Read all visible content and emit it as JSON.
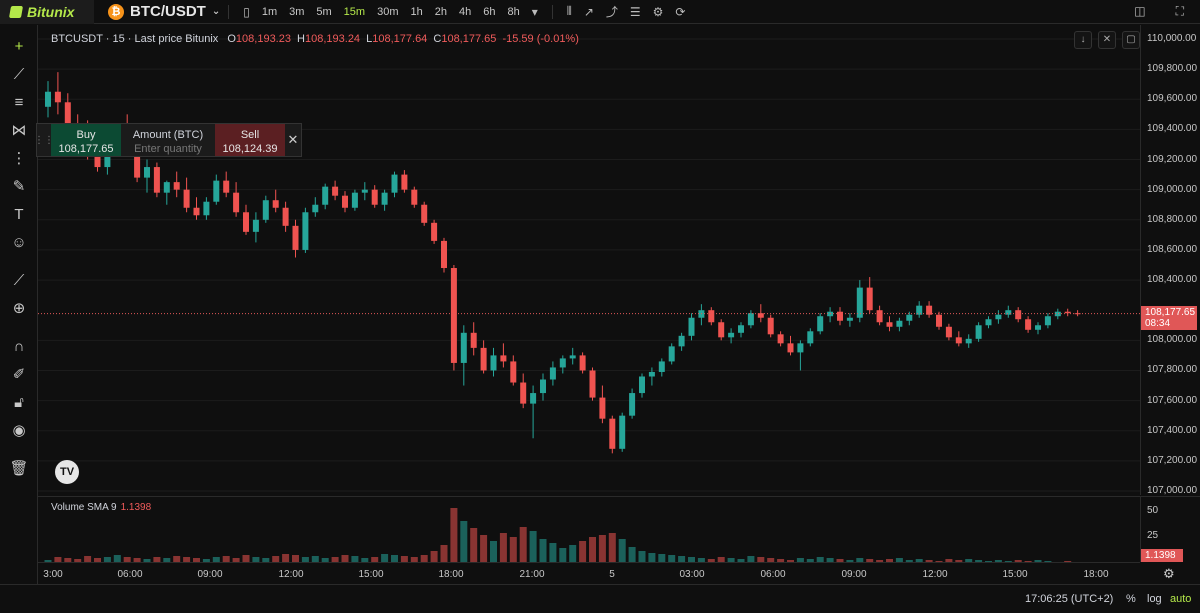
{
  "topbar": {
    "brand": "Bitunix",
    "symbol": "BTC/USDT",
    "timeframes": [
      {
        "label": "1m",
        "active": false
      },
      {
        "label": "3m",
        "active": false
      },
      {
        "label": "5m",
        "active": false
      },
      {
        "label": "15m",
        "active": true
      },
      {
        "label": "30m",
        "active": false
      },
      {
        "label": "1h",
        "active": false
      },
      {
        "label": "2h",
        "active": false
      },
      {
        "label": "4h",
        "active": false
      },
      {
        "label": "6h",
        "active": false
      },
      {
        "label": "8h",
        "active": false
      }
    ]
  },
  "legend": {
    "title": "BTCUSDT · 15 · Last price Bitunix",
    "o_label": "O",
    "o": "108,193.23",
    "h_label": "H",
    "h": "108,193.24",
    "l_label": "L",
    "l": "108,177.64",
    "c_label": "C",
    "c": "108,177.65",
    "change": "-15.59 (-0.01%)"
  },
  "order_panel": {
    "buy_label": "Buy",
    "buy_price": "108,177.65",
    "amount_label": "Amount (BTC)",
    "amount_placeholder": "Enter quantity",
    "sell_label": "Sell",
    "sell_price": "108,124.39"
  },
  "price_axis": {
    "ticks": [
      "110,000.00",
      "109,800.00",
      "109,600.00",
      "109,400.00",
      "109,200.00",
      "109,000.00",
      "108,800.00",
      "108,600.00",
      "108,400.00",
      "108,000.00",
      "107,800.00",
      "107,600.00",
      "107,400.00",
      "107,200.00",
      "107,000.00"
    ],
    "last_price": "108,177.65",
    "countdown": "08:34"
  },
  "volume": {
    "label": "Volume SMA 9",
    "value": "1.1398",
    "ticks": [
      "50",
      "25"
    ],
    "last": "1.1398"
  },
  "time_axis": {
    "ticks": [
      "3:00",
      "06:00",
      "09:00",
      "12:00",
      "15:00",
      "18:00",
      "21:00",
      "5",
      "03:00",
      "06:00",
      "09:00",
      "12:00",
      "15:00",
      "18:00"
    ]
  },
  "status": {
    "time": "17:06:25 (UTC+2)",
    "percent": "%",
    "log": "log",
    "auto": "auto"
  },
  "colors": {
    "up": "#26a69a",
    "down": "#ef5350",
    "accent": "#b4e84a"
  },
  "chart_data": {
    "type": "candlestick",
    "ylim": [
      107000,
      110000
    ],
    "candles": [
      [
        109550,
        109720,
        109480,
        109650
      ],
      [
        109650,
        109780,
        109500,
        109580
      ],
      [
        109580,
        109640,
        109380,
        109420
      ],
      [
        109420,
        109500,
        109300,
        109380
      ],
      [
        109380,
        109460,
        109200,
        109260
      ],
      [
        109260,
        109320,
        109120,
        109150
      ],
      [
        109150,
        109330,
        109100,
        109300
      ],
      [
        109300,
        109420,
        109250,
        109380
      ],
      [
        109380,
        109500,
        109220,
        109250
      ],
      [
        109250,
        109300,
        109050,
        109080
      ],
      [
        109080,
        109200,
        108980,
        109150
      ],
      [
        109150,
        109180,
        108950,
        108980
      ],
      [
        108980,
        109060,
        108900,
        109050
      ],
      [
        109050,
        109120,
        108950,
        109000
      ],
      [
        109000,
        109080,
        108850,
        108880
      ],
      [
        108880,
        108950,
        108800,
        108830
      ],
      [
        108830,
        108950,
        108800,
        108920
      ],
      [
        108920,
        109100,
        108900,
        109060
      ],
      [
        109060,
        109120,
        108950,
        108980
      ],
      [
        108980,
        109050,
        108820,
        108850
      ],
      [
        108850,
        108900,
        108700,
        108720
      ],
      [
        108720,
        108850,
        108650,
        108800
      ],
      [
        108800,
        108960,
        108780,
        108930
      ],
      [
        108930,
        109000,
        108850,
        108880
      ],
      [
        108880,
        108920,
        108720,
        108760
      ],
      [
        108760,
        108800,
        108550,
        108600
      ],
      [
        108600,
        108880,
        108580,
        108850
      ],
      [
        108850,
        108950,
        108820,
        108900
      ],
      [
        108900,
        109040,
        108870,
        109020
      ],
      [
        109020,
        109060,
        108930,
        108960
      ],
      [
        108960,
        108990,
        108850,
        108880
      ],
      [
        108880,
        109000,
        108860,
        108980
      ],
      [
        108980,
        109050,
        108930,
        109000
      ],
      [
        109000,
        109030,
        108880,
        108900
      ],
      [
        108900,
        109000,
        108860,
        108980
      ],
      [
        108980,
        109120,
        108950,
        109100
      ],
      [
        109100,
        109130,
        108980,
        109000
      ],
      [
        109000,
        109020,
        108880,
        108900
      ],
      [
        108900,
        108920,
        108760,
        108780
      ],
      [
        108780,
        108800,
        108640,
        108660
      ],
      [
        108660,
        108680,
        108450,
        108480
      ],
      [
        108480,
        108500,
        107800,
        107850
      ],
      [
        107850,
        108100,
        107700,
        108050
      ],
      [
        108050,
        108120,
        107900,
        107950
      ],
      [
        107950,
        108000,
        107780,
        107800
      ],
      [
        107800,
        107950,
        107760,
        107900
      ],
      [
        107900,
        107980,
        107820,
        107860
      ],
      [
        107860,
        107900,
        107700,
        107720
      ],
      [
        107720,
        107780,
        107550,
        107580
      ],
      [
        107580,
        107700,
        107350,
        107650
      ],
      [
        107650,
        107780,
        107600,
        107740
      ],
      [
        107740,
        107860,
        107700,
        107820
      ],
      [
        107820,
        107900,
        107780,
        107880
      ],
      [
        107880,
        107950,
        107840,
        107900
      ],
      [
        107900,
        107920,
        107780,
        107800
      ],
      [
        107800,
        107820,
        107600,
        107620
      ],
      [
        107620,
        107700,
        107450,
        107480
      ],
      [
        107480,
        107500,
        107250,
        107280
      ],
      [
        107280,
        107520,
        107260,
        107500
      ],
      [
        107500,
        107680,
        107480,
        107650
      ],
      [
        107650,
        107780,
        107620,
        107760
      ],
      [
        107760,
        107820,
        107700,
        107790
      ],
      [
        107790,
        107880,
        107760,
        107860
      ],
      [
        107860,
        107980,
        107840,
        107960
      ],
      [
        107960,
        108050,
        107930,
        108030
      ],
      [
        108030,
        108180,
        108000,
        108150
      ],
      [
        108150,
        108240,
        108100,
        108200
      ],
      [
        108200,
        108220,
        108100,
        108120
      ],
      [
        108120,
        108140,
        108000,
        108020
      ],
      [
        108020,
        108080,
        107980,
        108050
      ],
      [
        108050,
        108120,
        108020,
        108100
      ],
      [
        108100,
        108200,
        108080,
        108180
      ],
      [
        108180,
        108240,
        108120,
        108150
      ],
      [
        108150,
        108170,
        108020,
        108040
      ],
      [
        108040,
        108060,
        107960,
        107980
      ],
      [
        107980,
        108030,
        107900,
        107920
      ],
      [
        107920,
        108000,
        107800,
        107980
      ],
      [
        107980,
        108080,
        107960,
        108060
      ],
      [
        108060,
        108180,
        108040,
        108160
      ],
      [
        108160,
        108220,
        108120,
        108190
      ],
      [
        108190,
        108220,
        108100,
        108130
      ],
      [
        108130,
        108180,
        108090,
        108150
      ],
      [
        108150,
        108400,
        108120,
        108350
      ],
      [
        108350,
        108420,
        108180,
        108200
      ],
      [
        108200,
        108230,
        108100,
        108120
      ],
      [
        108120,
        108160,
        108060,
        108090
      ],
      [
        108090,
        108150,
        108060,
        108130
      ],
      [
        108130,
        108190,
        108100,
        108170
      ],
      [
        108170,
        108260,
        108150,
        108230
      ],
      [
        108230,
        108260,
        108150,
        108170
      ],
      [
        108170,
        108190,
        108070,
        108090
      ],
      [
        108090,
        108110,
        108000,
        108020
      ],
      [
        108020,
        108060,
        107960,
        107980
      ],
      [
        107980,
        108040,
        107950,
        108010
      ],
      [
        108010,
        108120,
        107990,
        108100
      ],
      [
        108100,
        108160,
        108080,
        108140
      ],
      [
        108140,
        108200,
        108110,
        108170
      ],
      [
        108170,
        108230,
        108150,
        108200
      ],
      [
        108200,
        108220,
        108120,
        108140
      ],
      [
        108140,
        108160,
        108050,
        108070
      ],
      [
        108070,
        108120,
        108040,
        108100
      ],
      [
        108100,
        108180,
        108080,
        108160
      ],
      [
        108160,
        108210,
        108140,
        108190
      ],
      [
        108190,
        108210,
        108160,
        108180
      ],
      [
        108180,
        108200,
        108160,
        108178
      ]
    ],
    "volumes": [
      3,
      6,
      5,
      4,
      7,
      5,
      6,
      8,
      6,
      5,
      4,
      6,
      5,
      7,
      6,
      5,
      4,
      6,
      7,
      5,
      8,
      6,
      5,
      7,
      9,
      8,
      6,
      7,
      5,
      6,
      8,
      7,
      5,
      6,
      9,
      8,
      7,
      6,
      8,
      12,
      18,
      55,
      42,
      35,
      28,
      22,
      30,
      26,
      36,
      32,
      24,
      20,
      15,
      18,
      22,
      26,
      28,
      30,
      24,
      16,
      12,
      10,
      9,
      8,
      7,
      6,
      5,
      4,
      6,
      5,
      4,
      7,
      6,
      5,
      4,
      3,
      5,
      4,
      6,
      5,
      4,
      3,
      5,
      4,
      3,
      4,
      5,
      3,
      4,
      3,
      2,
      4,
      3,
      4,
      3,
      2,
      3,
      2,
      3,
      2,
      3,
      2,
      1,
      2
    ]
  }
}
